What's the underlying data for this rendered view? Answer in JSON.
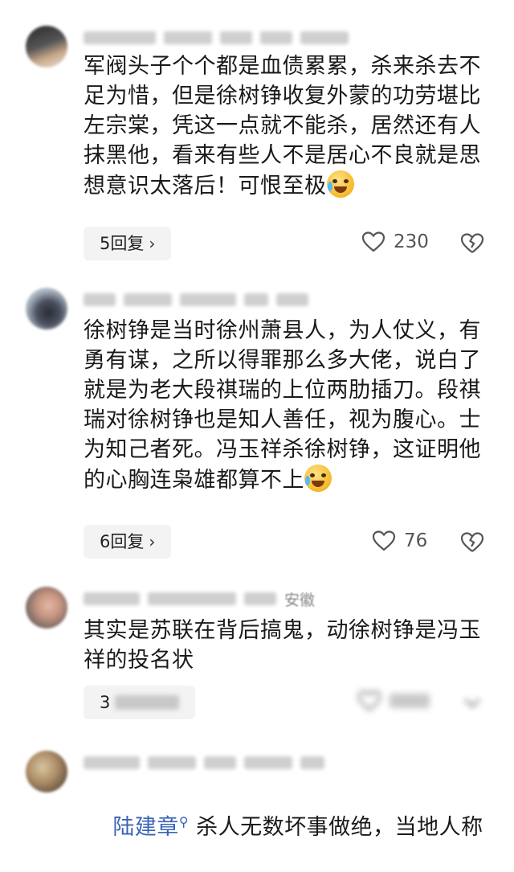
{
  "comments": [
    {
      "text": "军阀头子个个都是血债累累，杀来杀去不足为惜，但是徐树铮收复外蒙的功劳堪比左宗棠，凭这一点就不能杀，居然还有人抹黑他，看来有些人不是居心不良就是思想意识太落后！可恨至极",
      "reply_label": "5回复",
      "likes": "230"
    },
    {
      "text": "徐树铮是当时徐州萧县人，为人仗义，有勇有谋，之所以得罪那么多大佬，说白了就是为老大段祺瑞的上位两肋插刀。段祺瑞对徐树铮也是知人善任，视为腹心。士为知己者死。冯玉祥杀徐树铮，这证明他的心胸连枭雄都算不上",
      "reply_label": "6回复",
      "likes": "76"
    },
    {
      "meta_location": "安徽",
      "text": "其实是苏联在背后搞鬼，动徐树铮是冯玉祥的投名状",
      "reply_label": "3"
    },
    {
      "mention": "陆建章",
      "text": "杀人无数坏事做绝，当地人称"
    }
  ],
  "icons": {
    "like": "heart-outline-icon",
    "dislike": "broken-heart-icon",
    "chevron": "chevron-right-icon"
  },
  "colors": {
    "link": "#3a63b8",
    "reply_bg": "#f3f3f3"
  }
}
